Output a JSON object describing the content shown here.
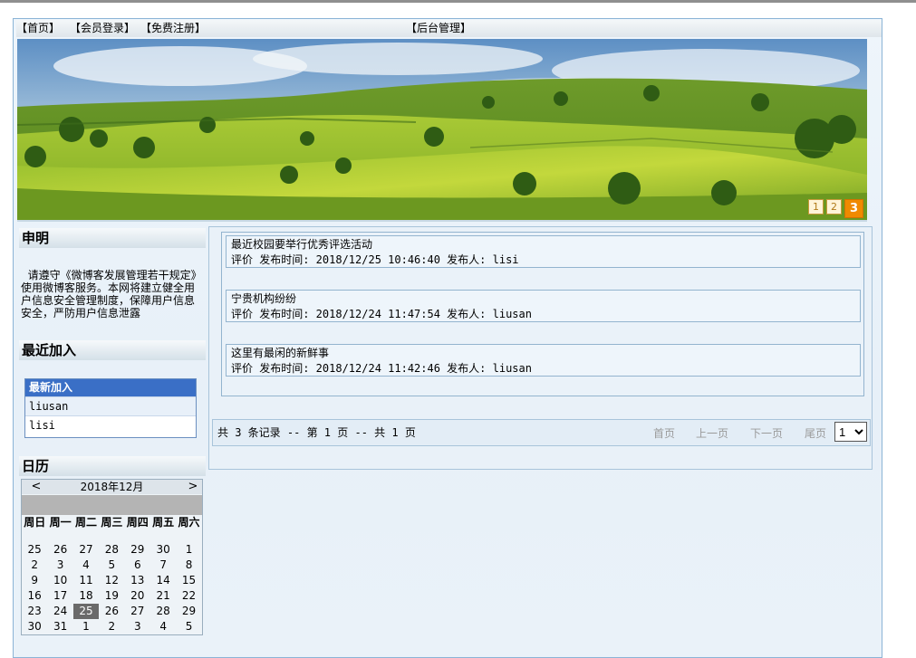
{
  "nav": {
    "home": "【首页】",
    "login": "【会员登录】",
    "register": "【免费注册】",
    "admin": "【后台管理】"
  },
  "banner": {
    "slides": [
      "1",
      "2",
      "3"
    ],
    "active_slide": "3"
  },
  "statement": {
    "title": "申明",
    "text": "请遵守《微博客发展管理若干规定》使用微博客服务。本网将建立健全用户信息安全管理制度，保障用户信息安全，严防用户信息泄露"
  },
  "recent": {
    "title": "最近加入",
    "header": "最新加入",
    "users": [
      "liusan",
      "lisi"
    ]
  },
  "calendar": {
    "title": "日历",
    "month_label": "2018年12月",
    "prev": "<",
    "next": ">",
    "weekdays": [
      "周日",
      "周一",
      "周二",
      "周三",
      "周四",
      "周五",
      "周六"
    ],
    "weeks": [
      [
        "25",
        "26",
        "27",
        "28",
        "29",
        "30",
        "1"
      ],
      [
        "2",
        "3",
        "4",
        "5",
        "6",
        "7",
        "8"
      ],
      [
        "9",
        "10",
        "11",
        "12",
        "13",
        "14",
        "15"
      ],
      [
        "16",
        "17",
        "18",
        "19",
        "20",
        "21",
        "22"
      ],
      [
        "23",
        "24",
        "25",
        "26",
        "27",
        "28",
        "29"
      ],
      [
        "30",
        "31",
        "1",
        "2",
        "3",
        "4",
        "5"
      ]
    ],
    "today": "25"
  },
  "news": [
    {
      "title": "最近校园要举行优秀评选活动",
      "meta": "评价 发布时间: 2018/12/25 10:46:40 发布人: lisi"
    },
    {
      "title": "宁贵机构纷纷",
      "meta": "评价 发布时间: 2018/12/24 11:47:54 发布人: liusan"
    },
    {
      "title": "这里有最闲的新鲜事",
      "meta": "评价 发布时间: 2018/12/24 11:42:46 发布人: liusan"
    }
  ],
  "pager": {
    "info": "共 3 条记录 -- 第 1 页 -- 共 1 页",
    "first": "首页",
    "prev": "上一页",
    "next": "下一页",
    "last": "尾页",
    "current_page": "1"
  }
}
